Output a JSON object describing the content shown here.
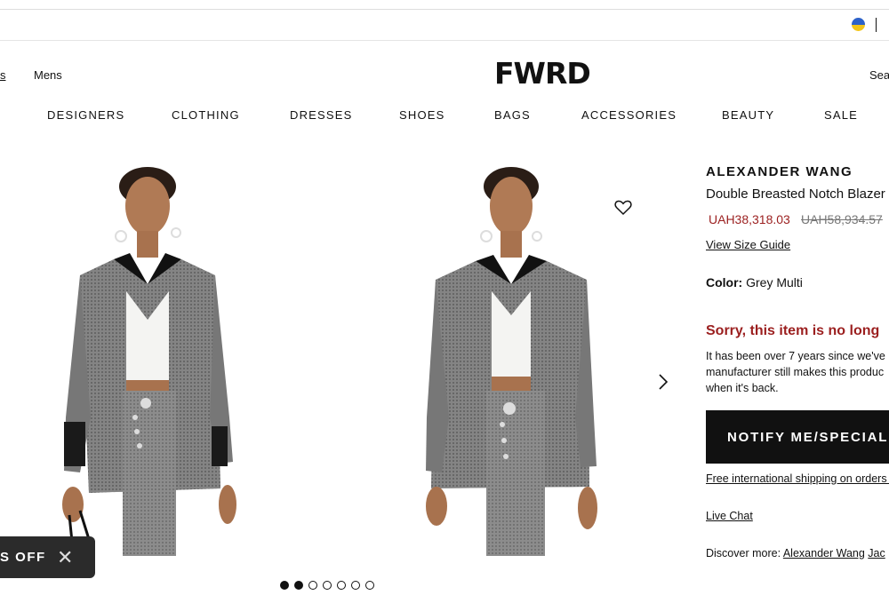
{
  "header": {
    "gender_left_label": "s",
    "gender_mens_label": "Mens",
    "logo": "FWRD",
    "search_label": "Sea"
  },
  "nav": {
    "items": [
      "DESIGNERS",
      "CLOTHING",
      "DRESSES",
      "SHOES",
      "BAGS",
      "ACCESSORIES",
      "BEAUTY",
      "SALE"
    ]
  },
  "gallery": {
    "dots_total": 7,
    "active_dots": [
      0,
      1
    ]
  },
  "promo": {
    "label": "S OFF",
    "close": "✕"
  },
  "product": {
    "brand": "ALEXANDER WANG",
    "name": "Double Breasted Notch Blazer",
    "sale_price": "UAH38,318.03",
    "original_price": "UAH58,934.57",
    "size_guide": "View Size Guide",
    "color_label": "Color:",
    "color_value": "Grey Multi",
    "unavailable_title": "Sorry, this item is no long",
    "unavailable_desc": [
      "It has been over 7 years since we've",
      "manufacturer still makes this produc",
      "when it's back."
    ],
    "notify_button": "NOTIFY ME/SPECIAL O",
    "shipping_link": "Free international shipping on orders o",
    "live_chat": "Live Chat",
    "discover_label": "Discover more:",
    "discover_links": [
      "Alexander Wang",
      "Jac"
    ]
  },
  "colors": {
    "accent_red": "#9b1f1f",
    "flag_blue": "#2d62c9",
    "flag_yellow": "#f3c518"
  }
}
